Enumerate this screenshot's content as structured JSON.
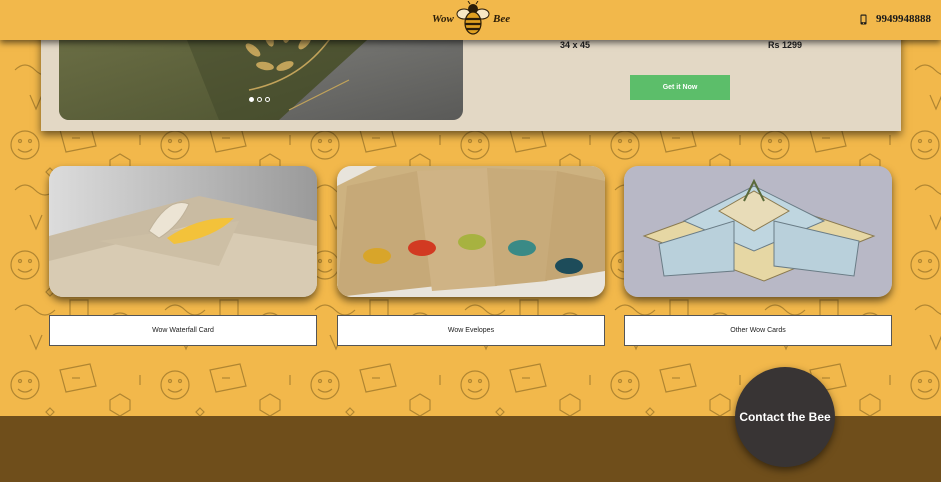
{
  "header": {
    "logo_left": "Wow",
    "logo_right": "Bee",
    "phone": "9949948888"
  },
  "product": {
    "size": "34 x 45",
    "price": "Rs 1299",
    "cta_label": "Get it Now",
    "slider_dots": 3,
    "active_dot": 1
  },
  "cards": [
    {
      "label": "Wow Waterfall Card"
    },
    {
      "label": "Wow Evelopes"
    },
    {
      "label": "Other Wow Cards"
    }
  ],
  "contact": {
    "label": "Contact the Bee"
  },
  "colors": {
    "background": "#f2b84b",
    "panel": "#e3d8c5",
    "cta": "#5cbe6a",
    "footer": "#6f4e1b",
    "contact_circle": "#383434"
  },
  "icons": {
    "phone": "mobile-phone-icon",
    "logo": "bee-icon"
  }
}
